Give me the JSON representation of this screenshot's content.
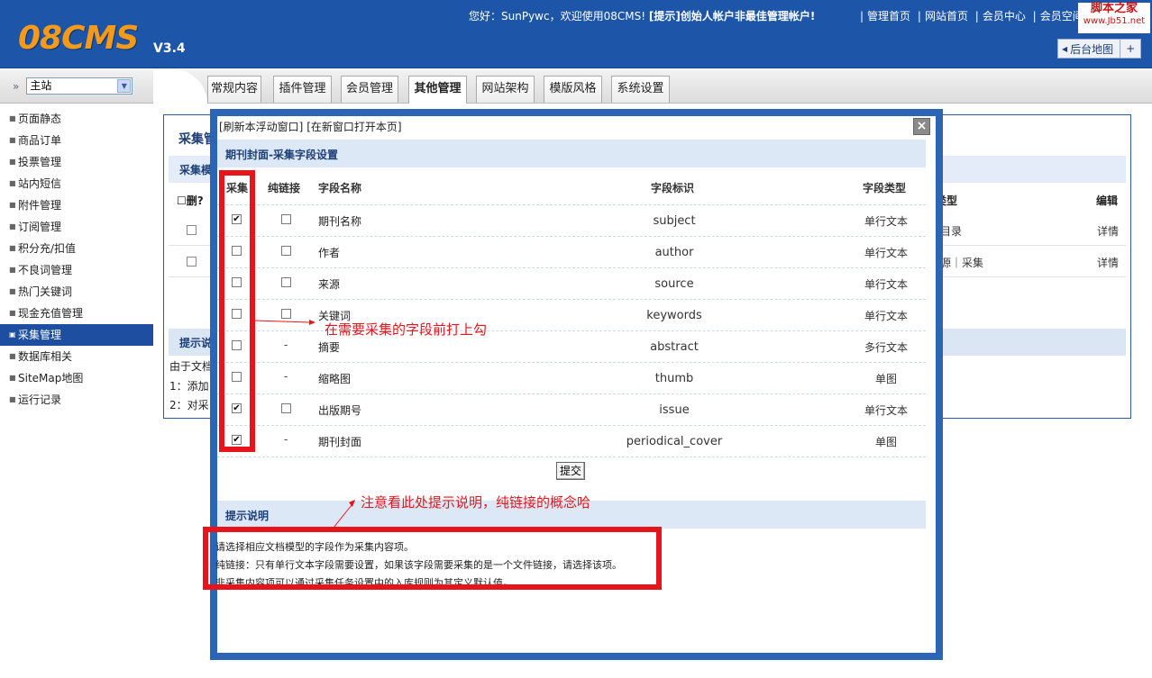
{
  "header": {
    "logo": "08CMS",
    "version": "V3.4",
    "welcome_prefix": "您好：SunPywc，欢迎使用08CMS!",
    "welcome_tip": "[提示]创始人帐户非最佳管理帐户!",
    "links": [
      "管理首页",
      "网站首页",
      "会员中心",
      "会员空间"
    ],
    "watermark_line1": "脚本之家",
    "watermark_line2": "www.Jb51.net",
    "sitemap_button": "后台地图",
    "sitemap_plus": "+"
  },
  "site_select": {
    "value": "主站"
  },
  "nav_tabs": [
    {
      "label": "常规内容",
      "active": false
    },
    {
      "label": "插件管理",
      "active": false
    },
    {
      "label": "会员管理",
      "active": false
    },
    {
      "label": "其他管理",
      "active": true
    },
    {
      "label": "网站架构",
      "active": false
    },
    {
      "label": "模版风格",
      "active": false
    },
    {
      "label": "系统设置",
      "active": false
    }
  ],
  "sidebar": {
    "items": [
      {
        "label": "页面静态",
        "active": false
      },
      {
        "label": "商品订单",
        "active": false
      },
      {
        "label": "投票管理",
        "active": false
      },
      {
        "label": "站内短信",
        "active": false
      },
      {
        "label": "附件管理",
        "active": false
      },
      {
        "label": "订阅管理",
        "active": false
      },
      {
        "label": "积分充/扣值",
        "active": false
      },
      {
        "label": "不良词管理",
        "active": false
      },
      {
        "label": "热门关键词",
        "active": false
      },
      {
        "label": "现金充值管理",
        "active": false
      },
      {
        "label": "采集管理",
        "active": true
      },
      {
        "label": "数据库相关",
        "active": false
      },
      {
        "label": "SiteMap地图",
        "active": false
      },
      {
        "label": "运行记录",
        "active": false
      }
    ]
  },
  "background_panel": {
    "title": "采集管",
    "bar_title": "采集模",
    "del_header": "删?",
    "type_header": "类型",
    "edit_header": "编辑",
    "rows": [
      {
        "type": "目录",
        "edit": "详情"
      },
      {
        "type": "源｜采集",
        "edit": "详情"
      }
    ],
    "tip_bar": "提示说",
    "tips": [
      "由于文档",
      "1：添加",
      "2：对采"
    ]
  },
  "modal": {
    "refresh_link": "[刷新本浮动窗口]",
    "newwin_link": "[在新窗口打开本页]",
    "close": "×",
    "section_title": "期刊封面-采集字段设置",
    "headers": {
      "collect": "采集",
      "pure_link": "纯链接",
      "name": "字段名称",
      "ident": "字段标识",
      "type": "字段类型"
    },
    "fields": [
      {
        "collect": true,
        "pure_link": "checkbox",
        "name": "期刊名称",
        "ident": "subject",
        "type": "单行文本"
      },
      {
        "collect": false,
        "pure_link": "checkbox",
        "name": "作者",
        "ident": "author",
        "type": "单行文本"
      },
      {
        "collect": false,
        "pure_link": "checkbox",
        "name": "来源",
        "ident": "source",
        "type": "单行文本"
      },
      {
        "collect": false,
        "pure_link": "checkbox",
        "name": "关键词",
        "ident": "keywords",
        "type": "单行文本"
      },
      {
        "collect": false,
        "pure_link": "-",
        "name": "摘要",
        "ident": "abstract",
        "type": "多行文本"
      },
      {
        "collect": false,
        "pure_link": "-",
        "name": "缩略图",
        "ident": "thumb",
        "type": "单图"
      },
      {
        "collect": true,
        "pure_link": "checkbox",
        "name": "出版期号",
        "ident": "issue",
        "type": "单行文本"
      },
      {
        "collect": true,
        "pure_link": "-",
        "name": "期刊封面",
        "ident": "periodical_cover",
        "type": "单图"
      }
    ],
    "submit": "提交",
    "tip_title": "提示说明",
    "tips": [
      "请选择相应文档模型的字段作为采集内容项。",
      "纯链接：只有单行文本字段需要设置，如果该字段需要采集的是一个文件链接，请选择该项。",
      "非采集内容项可以通过采集任务设置中的入库规则为其定义默认值。"
    ]
  },
  "annotations": {
    "collect_note": "在需要采集的字段前打上勾",
    "tip_note": "注意看此处提示说明，纯链接的概念哈"
  },
  "colors": {
    "header_blue": "#1d56a8",
    "modal_border": "#2c65b5",
    "annotation_red": "#e8141c",
    "logo_orange": "#f39a1b"
  }
}
